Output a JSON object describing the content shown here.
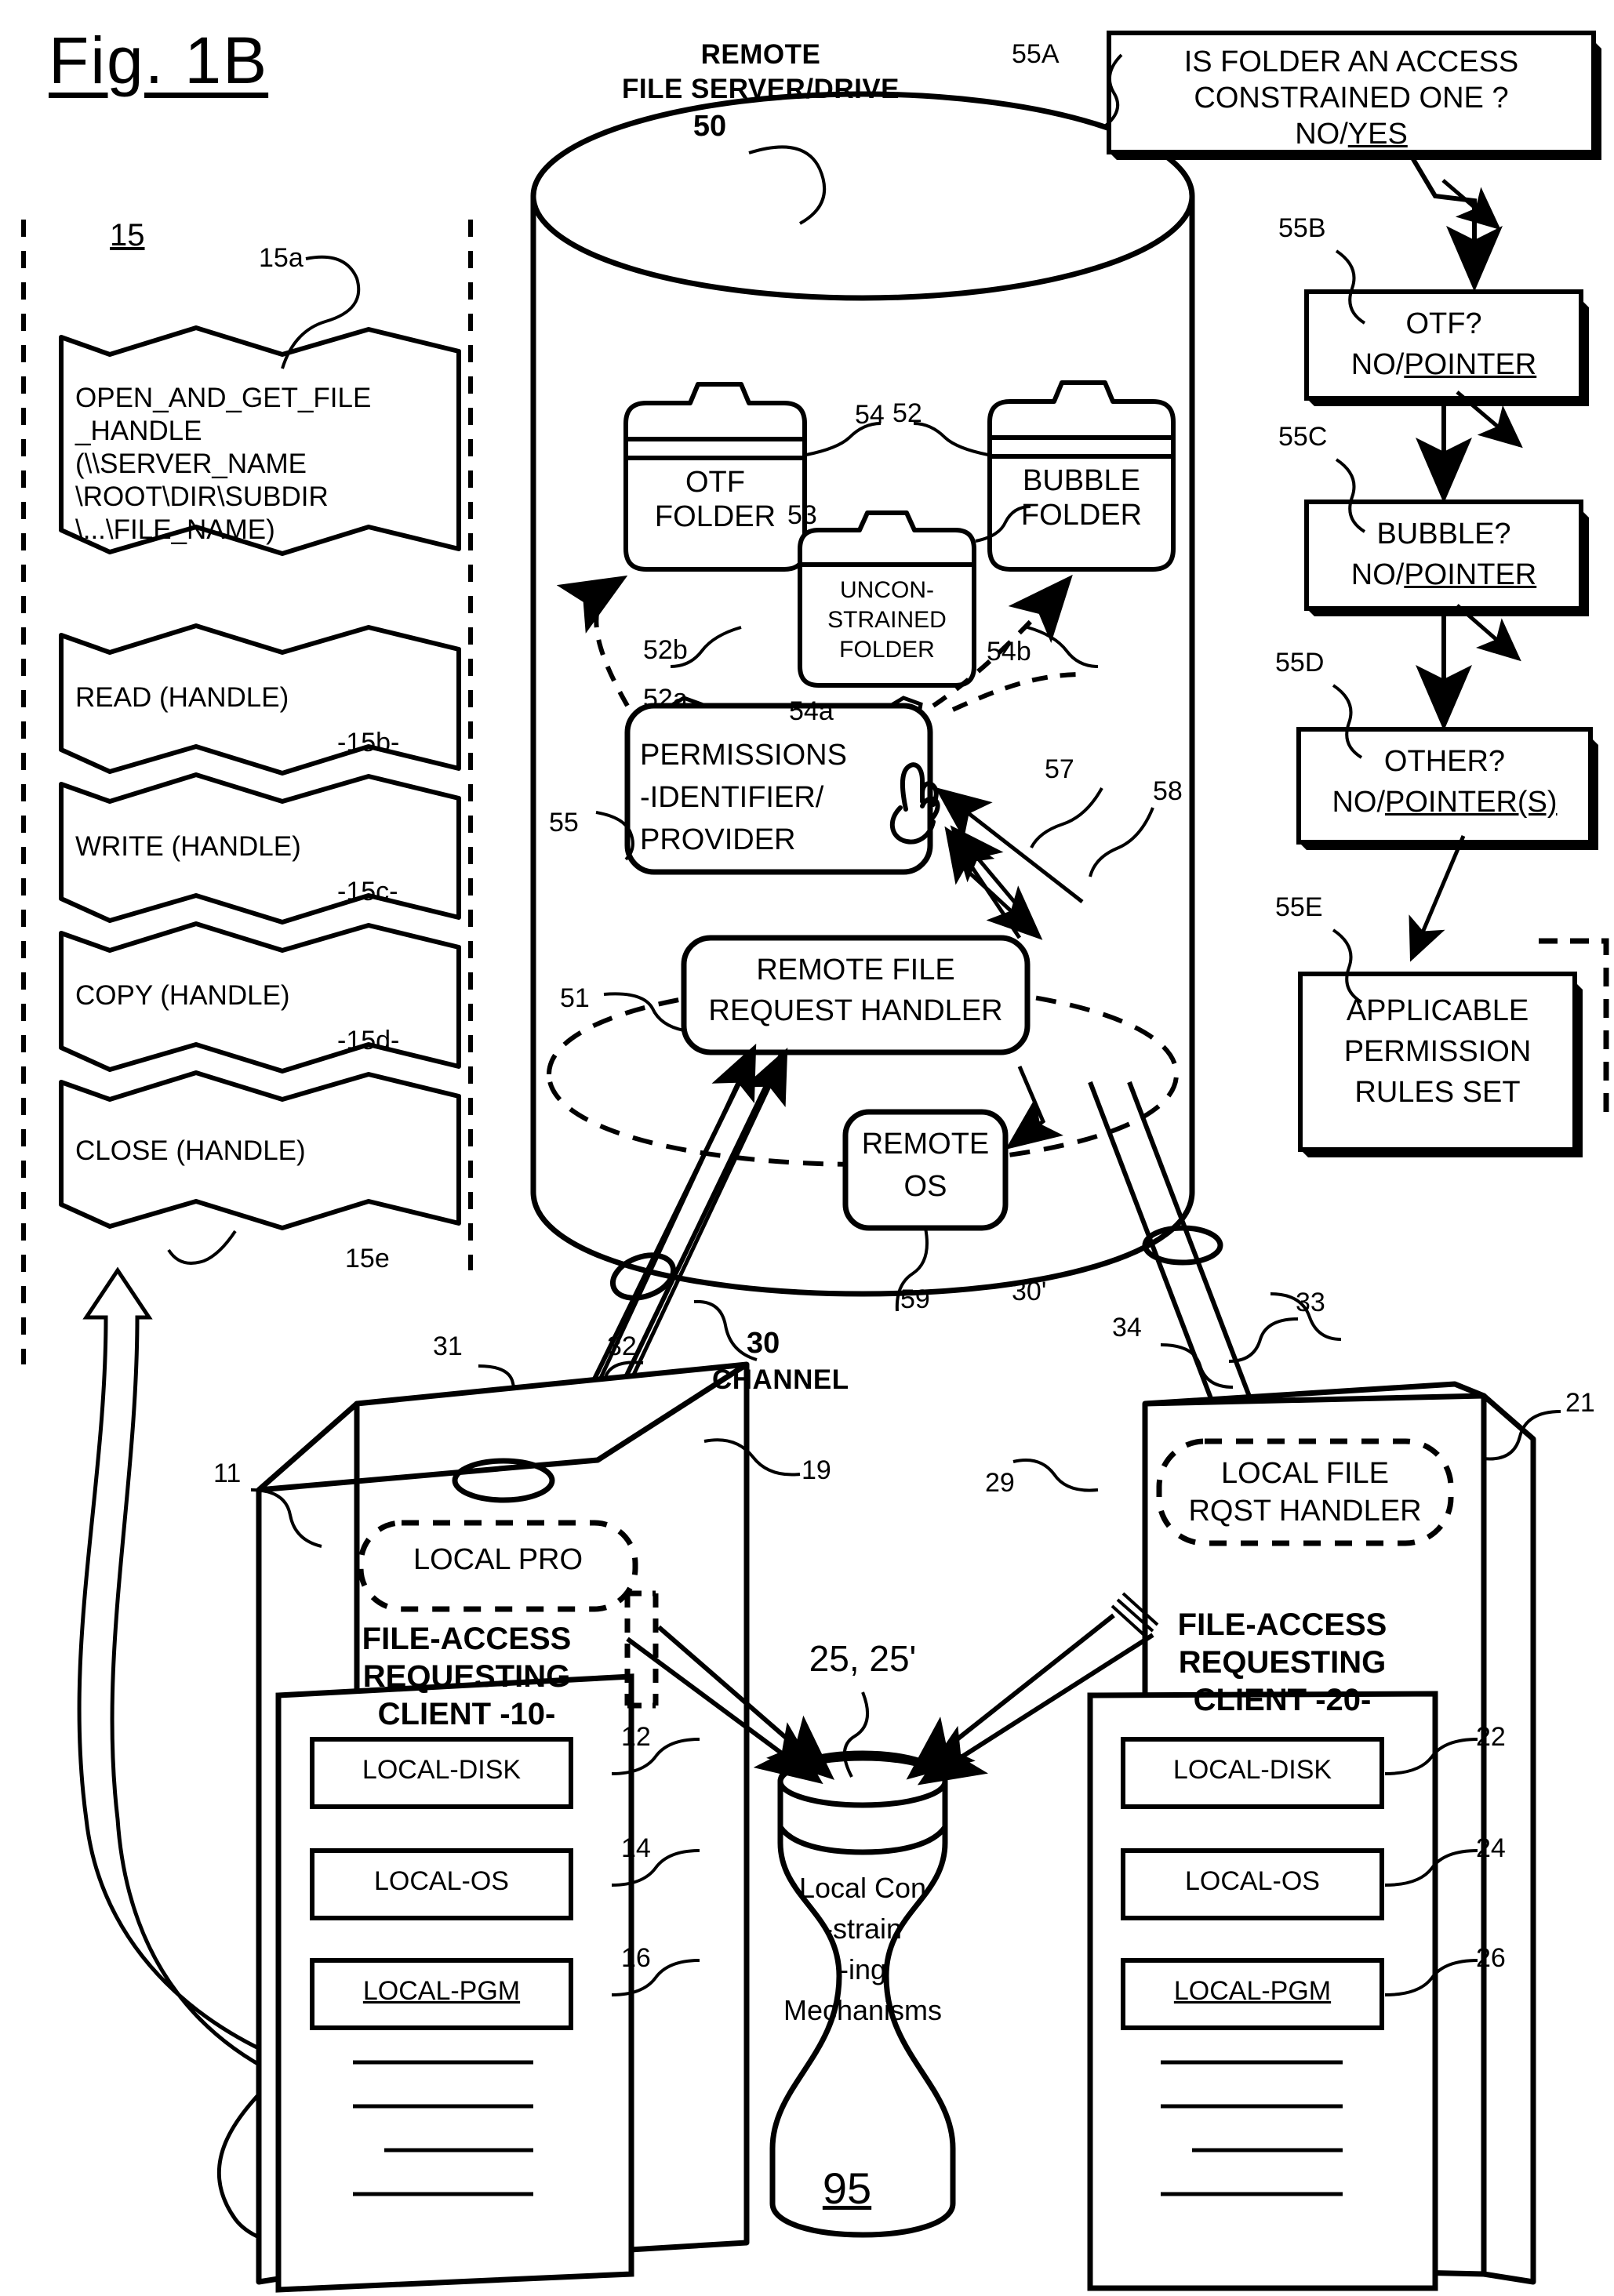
{
  "figure": {
    "title": "Fig. 1B",
    "bottom_ref": "95"
  },
  "server": {
    "title_line1": "REMOTE",
    "title_line2": "FILE SERVER/DRIVE",
    "ref": "50",
    "folders": [
      {
        "label_line1": "OTF",
        "label_line2": "FOLDER",
        "ref": "52",
        "ref_a": "52a",
        "ref_b": "52b"
      },
      {
        "label_line1": "UNCON-",
        "label_line2": "STRAINED",
        "label_line3": "FOLDER",
        "ref": "53"
      },
      {
        "label_line1": "BUBBLE",
        "label_line2": "FOLDER",
        "ref": "54",
        "ref_a": "54a",
        "ref_b": "54b"
      }
    ],
    "permissions_box": {
      "line1": "PERMISSIONS",
      "line2": "-IDENTIFIER/",
      "line3": "PROVIDER",
      "ref": "55"
    },
    "request_handler": {
      "line1": "REMOTE FILE",
      "line2": "REQUEST HANDLER",
      "ref": "51"
    },
    "remote_os": {
      "line1": "REMOTE",
      "line2": "OS",
      "ref": "59"
    },
    "arrow_refs": {
      "a57": "57",
      "a58": "58"
    }
  },
  "code_column": {
    "ref": "15",
    "blocks": [
      {
        "ref": "15a",
        "lines": [
          "OPEN_AND_GET_FILE",
          "_HANDLE",
          "(\\\\SERVER_NAME",
          "\\ROOT\\DIR\\SUBDIR",
          "\\...\\FILE_NAME)"
        ]
      },
      {
        "ref": "-15b-",
        "lines": [
          "READ (HANDLE)"
        ]
      },
      {
        "ref": "-15c-",
        "lines": [
          "WRITE (HANDLE)"
        ]
      },
      {
        "ref": "-15d-",
        "lines": [
          "COPY (HANDLE)"
        ]
      },
      {
        "ref": "15e",
        "lines": [
          "CLOSE (HANDLE)"
        ]
      }
    ]
  },
  "flowchart": {
    "steps": [
      {
        "ref": "55A",
        "line1": "IS FOLDER AN ACCESS",
        "line2": "CONSTRAINED ONE ?",
        "line3_plain": "NO/",
        "line3_ul": "YES"
      },
      {
        "ref": "55B",
        "line1": "OTF?",
        "line2_plain": "NO/",
        "line2_ul": "POINTER"
      },
      {
        "ref": "55C",
        "line1": "BUBBLE?",
        "line2_plain": "NO/",
        "line2_ul": "POINTER"
      },
      {
        "ref": "55D",
        "line1": "OTHER?",
        "line2_plain": "NO/",
        "line2_ul": "POINTER(S)"
      },
      {
        "ref": "55E",
        "line1": "APPLICABLE",
        "line2": "PERMISSION",
        "line3": "RULES SET"
      }
    ]
  },
  "channel": {
    "label": "CHANNEL",
    "ref": "30",
    "ref_prime": "30'",
    "refs": [
      "31",
      "32",
      "33",
      "34"
    ]
  },
  "client_left": {
    "local_pro": "LOCAL PRO",
    "ref_pro": "19",
    "ref_case": "11",
    "title_line1": "FILE-ACCESS",
    "title_line2": "REQUESTING",
    "title_line3": "CLIENT -10-",
    "items": [
      {
        "label": "LOCAL-DISK",
        "ref": "12",
        "underline": false
      },
      {
        "label": "LOCAL-OS",
        "ref": "14",
        "underline": false
      },
      {
        "label": "LOCAL-PGM",
        "ref": "16",
        "underline": true
      }
    ]
  },
  "client_right": {
    "handler_line1": "LOCAL FILE",
    "handler_line2": "RQST HANDLER",
    "ref_handler": "29",
    "ref_case": "21",
    "title_line1": "FILE-ACCESS",
    "title_line2": "REQUESTING",
    "title_line3": "CLIENT -20-",
    "items": [
      {
        "label": "LOCAL-DISK",
        "ref": "22",
        "underline": false
      },
      {
        "label": "LOCAL-OS",
        "ref": "24",
        "underline": false
      },
      {
        "label": "LOCAL-PGM",
        "ref": "26",
        "underline": true
      }
    ]
  },
  "constraining": {
    "ref": "25, 25'",
    "line1": "Local Con",
    "line2": "-strain",
    "line3": "-ing",
    "line4": "Mechanisms"
  }
}
